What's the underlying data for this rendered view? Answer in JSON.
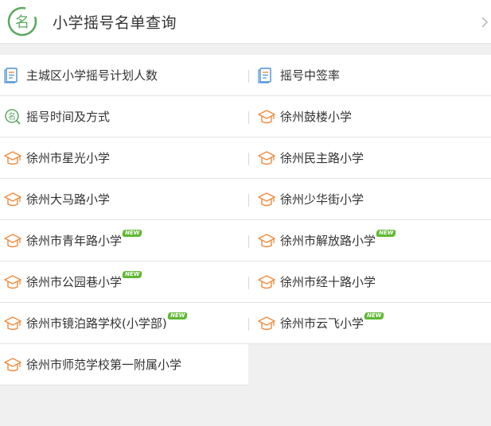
{
  "header": {
    "logo_char": "名",
    "title": "小学摇号名单查询"
  },
  "colors": {
    "accent_green": "#5aa95f",
    "school_orange": "#f08a3c",
    "doc_blue": "#4a90d9",
    "new_badge": "#5fb832"
  },
  "items": [
    {
      "label": "主城区小学摇号计划人数",
      "icon": "document-icon",
      "new": false
    },
    {
      "label": "摇号中签率",
      "icon": "document-icon",
      "new": false
    },
    {
      "label": "摇号时间及方式",
      "icon": "name-search-icon",
      "new": false
    },
    {
      "label": "徐州鼓楼小学",
      "icon": "graduation-cap-icon",
      "new": false
    },
    {
      "label": "徐州市星光小学",
      "icon": "graduation-cap-icon",
      "new": false
    },
    {
      "label": "徐州民主路小学",
      "icon": "graduation-cap-icon",
      "new": false
    },
    {
      "label": "徐州大马路小学",
      "icon": "graduation-cap-icon",
      "new": false
    },
    {
      "label": "徐州少华街小学",
      "icon": "graduation-cap-icon",
      "new": false
    },
    {
      "label": "徐州市青年路小学",
      "icon": "graduation-cap-icon",
      "new": true
    },
    {
      "label": "徐州市解放路小学",
      "icon": "graduation-cap-icon",
      "new": true
    },
    {
      "label": "徐州市公园巷小学",
      "icon": "graduation-cap-icon",
      "new": true
    },
    {
      "label": "徐州市经十路小学",
      "icon": "graduation-cap-icon",
      "new": false
    },
    {
      "label": "徐州市镜泊路学校(小学部)",
      "icon": "graduation-cap-icon",
      "new": true
    },
    {
      "label": "徐州市云飞小学",
      "icon": "graduation-cap-icon",
      "new": true
    },
    {
      "label": "徐州市师范学校第一附属小学",
      "icon": "graduation-cap-icon",
      "new": false
    }
  ],
  "badge_text": "NEW"
}
